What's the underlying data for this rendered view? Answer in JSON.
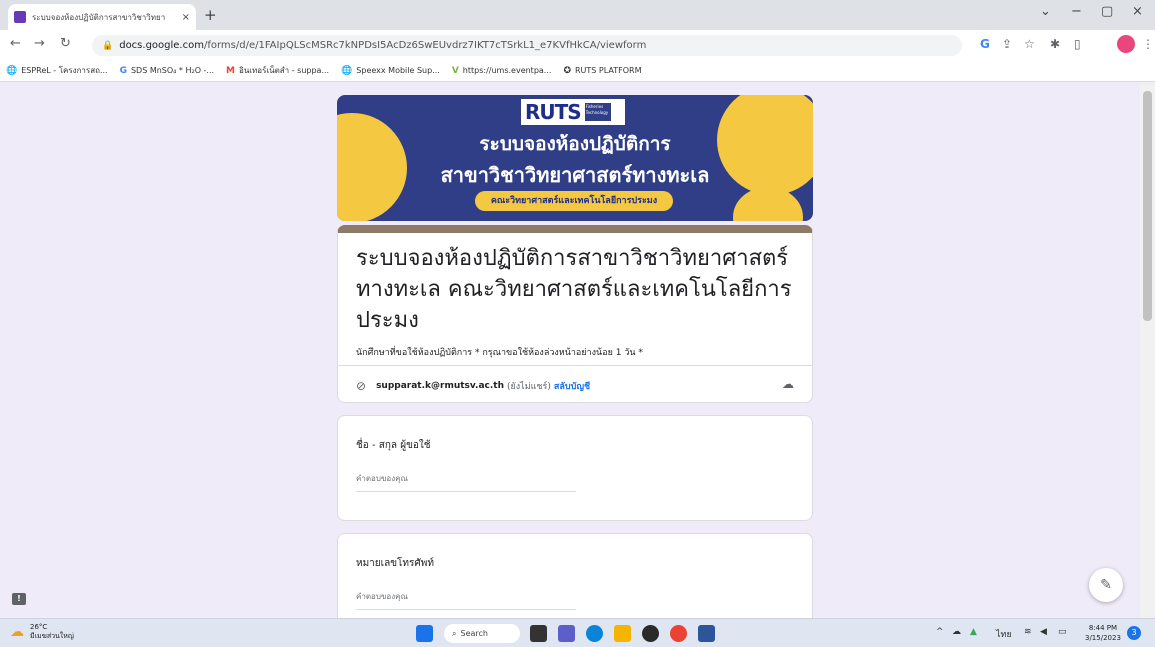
{
  "browser": {
    "tab_title": "ระบบจองห้องปฏิบัติการสาขาวิชาวิทยา",
    "tab_close": "×",
    "new_tab": "+",
    "window_controls": [
      "⌄",
      "−",
      "▢",
      "×"
    ],
    "url_host": "docs.google.com",
    "url_path": "/forms/d/e/1FAIpQLScMSRc7kNPDsI5AcDz6SwEUvdrz7IKT7cTSrkL1_e7KVfHkCA/viewform",
    "bookmarks": [
      {
        "icon": "globe-icon",
        "glyph": "🌐",
        "label": "ESPReL - โครงการสถ..."
      },
      {
        "icon": "google-icon",
        "glyph": "G",
        "label": "SDS MnSO₄ * H₂O -..."
      },
      {
        "icon": "gmail-icon",
        "glyph": "M",
        "label": "อินเทอร์เน็ตสำ - suppa..."
      },
      {
        "icon": "globe-icon",
        "glyph": "🌐",
        "label": "Speexx Mobile Sup..."
      },
      {
        "icon": "v-icon",
        "glyph": "V",
        "label": "https://ums.eventpa..."
      },
      {
        "icon": "ruts-icon",
        "glyph": "✪",
        "label": "RUTS PLATFORM"
      }
    ]
  },
  "banner": {
    "logo": "RUTS",
    "logo_sub": "Fisheries Technology",
    "line1": "ระบบจองห้องปฏิบัติการ",
    "line2": "สาขาวิชาวิทยาศาสตร์ทางทะเล",
    "pill": "คณะวิทยาศาสตร์และเทคโนโลยีการประมง"
  },
  "form": {
    "title": "ระบบจองห้องปฏิบัติการสาขาวิชาวิทยาศาสตร์ทางทะเล คณะวิทยาศาสตร์และเทคโนโลยีการประมง",
    "description": "นักศึกษาที่ขอใช้ห้องปฏิบัติการ * กรุณาขอใช้ห้องล่วงหน้าอย่างน้อย 1 วัน *",
    "account_email": "supparat.k@rmutsv.ac.th",
    "account_note": "(ยังไม่แชร์)",
    "switch_account": "สลับบัญชี",
    "questions": [
      {
        "label": "ชื่อ - สกุล ผู้ขอใช้",
        "placeholder": "คำตอบของคุณ"
      },
      {
        "label": "หมายเลขโทรศัพท์",
        "placeholder": "คำตอบของคุณ"
      }
    ]
  },
  "taskbar": {
    "temp": "26°C",
    "weather_desc": "มีเมฆส่วนใหญ่",
    "search": "Search",
    "lang": "ไทย",
    "time": "8:44 PM",
    "date": "3/15/2023",
    "notifications": "3"
  },
  "colors": {
    "accent": "#8d7a67",
    "banner_bg": "#2f3e86",
    "banner_yellow": "#f5c842",
    "page_bg": "#f0ebf8",
    "link": "#1a73e8"
  }
}
